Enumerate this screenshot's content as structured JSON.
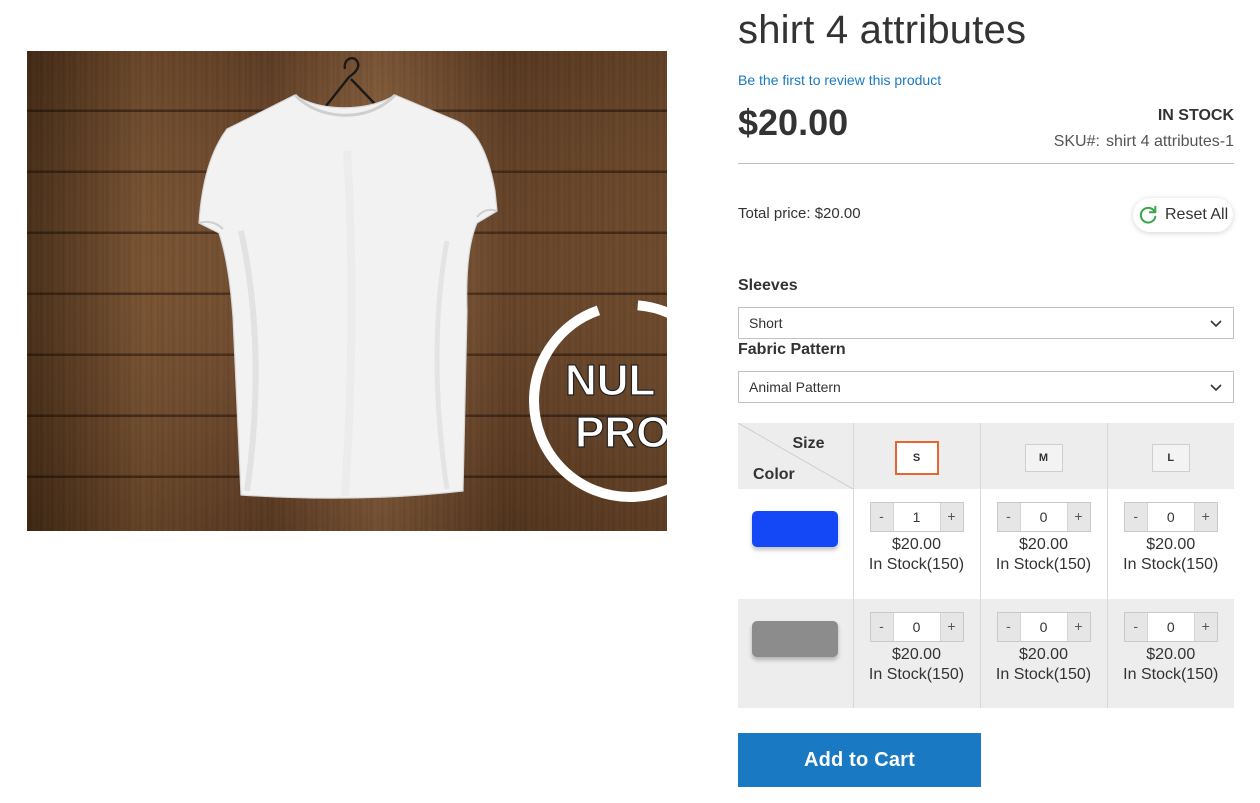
{
  "product": {
    "title": "shirt 4 attributes",
    "review_link": "Be the first to review this product",
    "price": "$20.00",
    "stock_status": "IN STOCK",
    "sku_label": "SKU#:",
    "sku_value": "shirt 4 attributes-1",
    "total_price": "Total price: $20.00",
    "image_watermark": [
      "NUL",
      "PRO"
    ]
  },
  "reset": {
    "label": "Reset All",
    "icon": "refresh-icon",
    "icon_color": "#3aa54a"
  },
  "attributes": {
    "sleeves": {
      "label": "Sleeves",
      "selected": "Short"
    },
    "fabric_pattern": {
      "label": "Fabric Pattern",
      "selected": "Animal Pattern"
    }
  },
  "matrix": {
    "size_header": "Size",
    "color_header": "Color",
    "sizes": [
      "S",
      "M",
      "L"
    ],
    "selected_size": "S",
    "rows": [
      {
        "color": "#1447f5",
        "cells": [
          {
            "qty": "1",
            "price": "$20.00",
            "stock": "In Stock(150)"
          },
          {
            "qty": "0",
            "price": "$20.00",
            "stock": "In Stock(150)"
          },
          {
            "qty": "0",
            "price": "$20.00",
            "stock": "In Stock(150)"
          }
        ]
      },
      {
        "color": "#8c8c8c",
        "cells": [
          {
            "qty": "0",
            "price": "$20.00",
            "stock": "In Stock(150)"
          },
          {
            "qty": "0",
            "price": "$20.00",
            "stock": "In Stock(150)"
          },
          {
            "qty": "0",
            "price": "$20.00",
            "stock": "In Stock(150)"
          }
        ]
      }
    ],
    "minus_label": "-",
    "plus_label": "+"
  },
  "add_to_cart": {
    "label": "Add to Cart",
    "color": "#1979c3"
  },
  "colors": {
    "link": "#1979c3",
    "selected_border": "#e5662e"
  }
}
